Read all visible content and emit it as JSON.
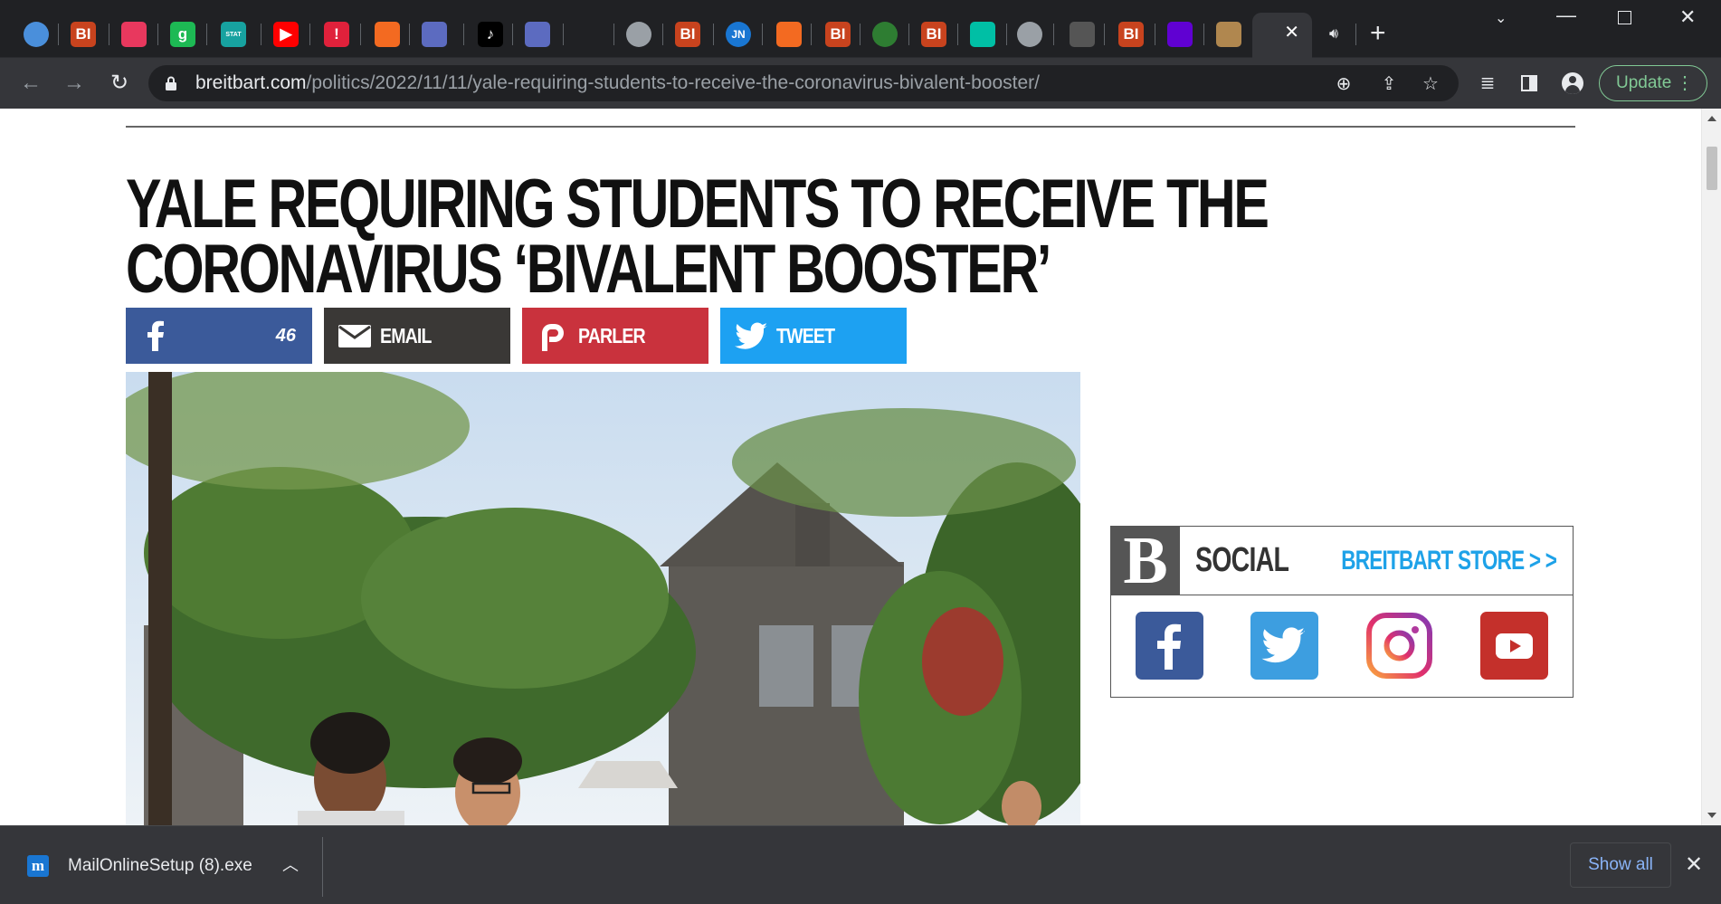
{
  "browser": {
    "tabs": [
      {
        "icon": "globe-icon",
        "color": "#4a8fdb",
        "text": ""
      },
      {
        "icon": "bi-icon",
        "color": "#c8431e",
        "text": "BI"
      },
      {
        "icon": "pinwheel-icon",
        "color": "#e8385e",
        "text": ""
      },
      {
        "icon": "g-icon",
        "color": "#1db954",
        "text": "g"
      },
      {
        "icon": "stat-icon",
        "color": "#17a2a0",
        "text": "STAT"
      },
      {
        "icon": "youtube-icon",
        "color": "#ff0000",
        "text": "▶"
      },
      {
        "icon": "alert-icon",
        "color": "#e0213b",
        "text": "!"
      },
      {
        "icon": "bookmark-stack-icon",
        "color": "#f36a21",
        "text": ""
      },
      {
        "icon": "arrow-icon",
        "color": "#5c6bc0",
        "text": ""
      },
      {
        "icon": "tiktok-icon",
        "color": "#000000",
        "text": "♪"
      },
      {
        "icon": "arrow-icon",
        "color": "#5c6bc0",
        "text": ""
      },
      {
        "icon": "globe-icon",
        "color": "#9aa0a6",
        "text": ""
      },
      {
        "icon": "bi-icon",
        "color": "#c8431e",
        "text": "BI"
      },
      {
        "icon": "jn-icon",
        "color": "#1976d2",
        "text": "JN"
      },
      {
        "icon": "bookmark-stack-icon",
        "color": "#f36a21",
        "text": ""
      },
      {
        "icon": "bi-icon",
        "color": "#c8431e",
        "text": "BI"
      },
      {
        "icon": "seal-icon",
        "color": "#2e7d32",
        "text": ""
      },
      {
        "icon": "bi-icon",
        "color": "#c8431e",
        "text": "BI"
      },
      {
        "icon": "bars-icon",
        "color": "#00bfa5",
        "text": ""
      },
      {
        "icon": "globe-icon",
        "color": "#9aa0a6",
        "text": ""
      },
      {
        "icon": "monogram-icon",
        "color": "#555555",
        "text": ""
      },
      {
        "icon": "bi-icon",
        "color": "#c8431e",
        "text": "BI"
      },
      {
        "icon": "mail-icon",
        "color": "#6001d2",
        "text": ""
      },
      {
        "icon": "portrait-icon",
        "color": "#b0874f",
        "text": ""
      }
    ],
    "new_tab_label": "+",
    "url_host": "breitbart.com",
    "url_path": "/politics/2022/11/11/yale-requiring-students-to-receive-the-coronavirus-bivalent-booster/",
    "update_label": "Update"
  },
  "article": {
    "headline_line1": "YALE REQUIRING STUDENTS TO RECEIVE THE",
    "headline_line2": "CORONAVIRUS ‘BIVALENT BOOSTER’",
    "share": {
      "facebook_count": "46",
      "email_label": "EMAIL",
      "parler_label": "PARLER",
      "tweet_label": "TWEET"
    }
  },
  "sidebar": {
    "logo_letter": "B",
    "social_title": "SOCIAL",
    "store_link": "BREITBART STORE > >",
    "social_icons": [
      {
        "name": "facebook-icon",
        "color": "#3b5a9a"
      },
      {
        "name": "twitter-icon",
        "color": "#3d9ee0"
      },
      {
        "name": "instagram-icon",
        "color": "#e1306c"
      },
      {
        "name": "youtube-icon",
        "color": "#c4302b"
      }
    ]
  },
  "downloads": {
    "file_name": "MailOnlineSetup (8).exe",
    "icon_letter": "m",
    "show_all_label": "Show all"
  }
}
